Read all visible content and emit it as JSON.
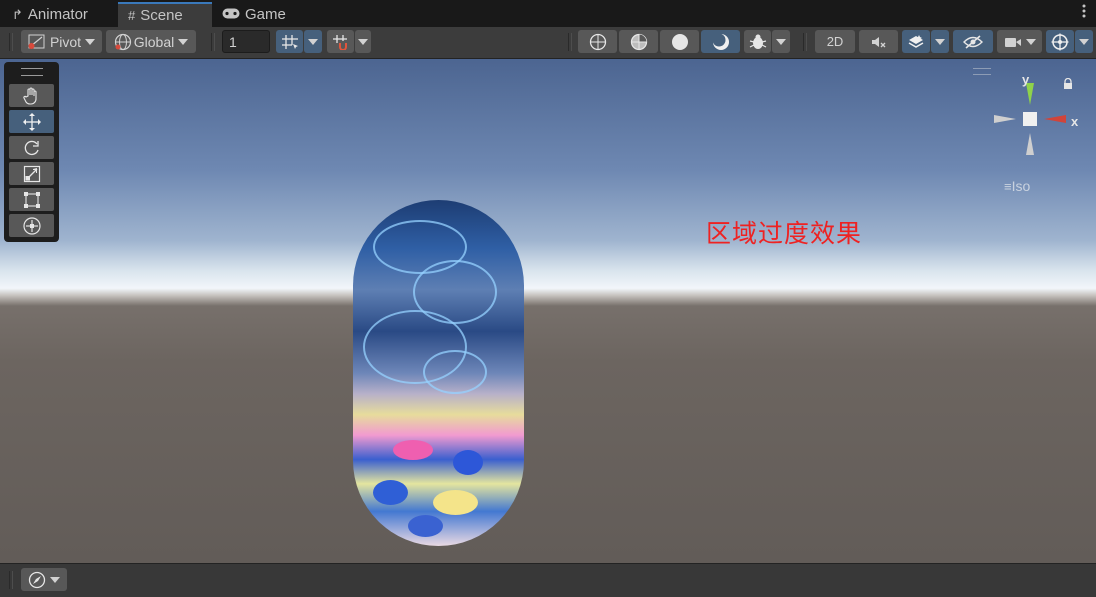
{
  "tabs": [
    {
      "label": "Animator",
      "icon": "animator-icon",
      "active": false
    },
    {
      "label": "Scene",
      "icon": "grid-hash-icon",
      "active": true
    },
    {
      "label": "Game",
      "icon": "gamepad-icon",
      "active": false
    }
  ],
  "toolbar": {
    "pivot_label": "Pivot",
    "global_label": "Global",
    "grid_snap_value": "1",
    "mode_2d_label": "2D"
  },
  "scene": {
    "annotation_text": "区域过度效果",
    "gizmo": {
      "y_label": "y",
      "x_label": "x",
      "projection_label": "Iso"
    }
  },
  "colors": {
    "accent": "#46607c",
    "annotation": "#ee2222",
    "tab_highlight": "#3a79bb",
    "gizmo_y": "#8fd24a",
    "gizmo_x": "#d1443a"
  }
}
